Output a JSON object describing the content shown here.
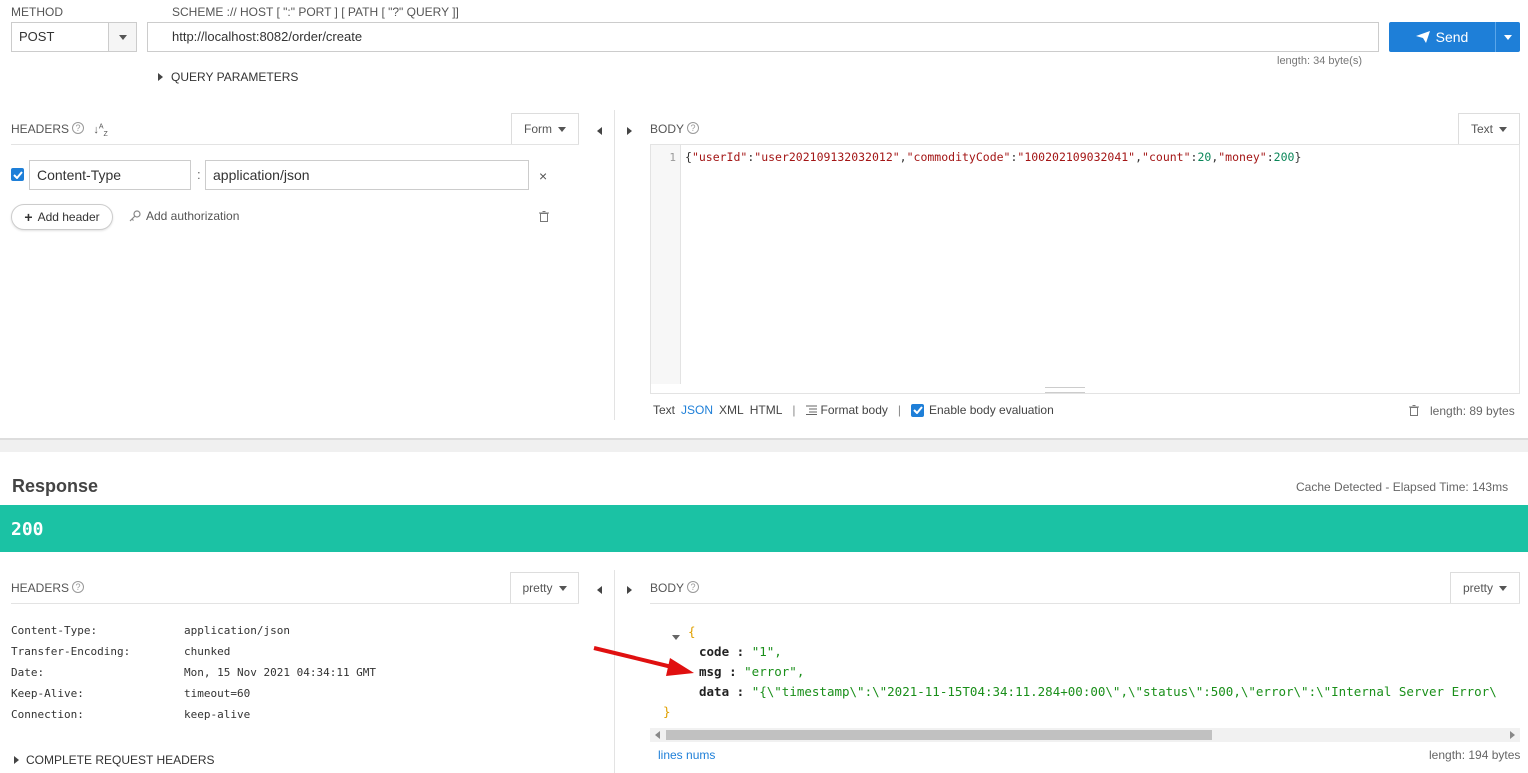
{
  "request": {
    "method_label": "METHOD",
    "method": "POST",
    "url_label": "SCHEME :// HOST [ \":\" PORT ] [ PATH [ \"?\" QUERY ]]",
    "url": "http://localhost:8082/order/create",
    "send_label": "Send",
    "url_length": "length: 34 byte(s)",
    "query_params_label": "QUERY PARAMETERS"
  },
  "req_headers": {
    "title": "HEADERS",
    "mode": "Form",
    "rows": [
      {
        "name": "Content-Type",
        "sep": ":",
        "value": "application/json"
      }
    ],
    "add_header": "Add header",
    "add_auth": "Add authorization"
  },
  "req_body": {
    "title": "BODY",
    "mode": "Text",
    "line_no": "1",
    "tokens": [
      {
        "t": "{",
        "c": "p"
      },
      {
        "t": "\"userId\"",
        "c": "s"
      },
      {
        "t": ":",
        "c": "p"
      },
      {
        "t": "\"user202109132032012\"",
        "c": "s"
      },
      {
        "t": ",",
        "c": "p"
      },
      {
        "t": "\"commodityCode\"",
        "c": "s"
      },
      {
        "t": ":",
        "c": "p"
      },
      {
        "t": "\"100202109032041\"",
        "c": "s"
      },
      {
        "t": ",",
        "c": "p"
      },
      {
        "t": "\"count\"",
        "c": "s"
      },
      {
        "t": ":",
        "c": "p"
      },
      {
        "t": "20",
        "c": "n"
      },
      {
        "t": ",",
        "c": "p"
      },
      {
        "t": "\"money\"",
        "c": "s"
      },
      {
        "t": ":",
        "c": "p"
      },
      {
        "t": "200",
        "c": "n"
      },
      {
        "t": "}",
        "c": "p"
      }
    ],
    "formats": [
      "Text",
      "JSON",
      "XML",
      "HTML"
    ],
    "active_format": "JSON",
    "format_body": "Format body",
    "enable_eval": "Enable body evaluation",
    "length": "length: 89 bytes"
  },
  "response": {
    "title": "Response",
    "elapsed": "Cache Detected - Elapsed Time: 143ms",
    "status": "200",
    "status_color": "#1bc2a4",
    "headers_title": "HEADERS",
    "headers_mode": "pretty",
    "headers": [
      {
        "name": "Content-Type:",
        "value": "application/json"
      },
      {
        "name": "Transfer-Encoding:",
        "value": "chunked"
      },
      {
        "name": "Date:",
        "value": "Mon, 15 Nov 2021 04:34:11 GMT"
      },
      {
        "name": "Keep-Alive:",
        "value": "timeout=60"
      },
      {
        "name": "Connection:",
        "value": "keep-alive"
      }
    ],
    "complete_headers": "COMPLETE REQUEST HEADERS",
    "body_title": "BODY",
    "body_mode": "pretty",
    "json": {
      "open": "{",
      "close": "}",
      "rows": [
        {
          "key": "code",
          "value": "\"1\","
        },
        {
          "key": "msg",
          "value": "\"error\","
        },
        {
          "key": "data",
          "value": "\"{\\\"timestamp\\\":\\\"2021-11-15T04:34:11.284+00:00\\\",\\\"status\\\":500,\\\"error\\\":\\\"Internal Server Error\\"
        }
      ],
      "colon": ":"
    },
    "lines_nums": "lines nums",
    "length": "length: 194 bytes"
  }
}
